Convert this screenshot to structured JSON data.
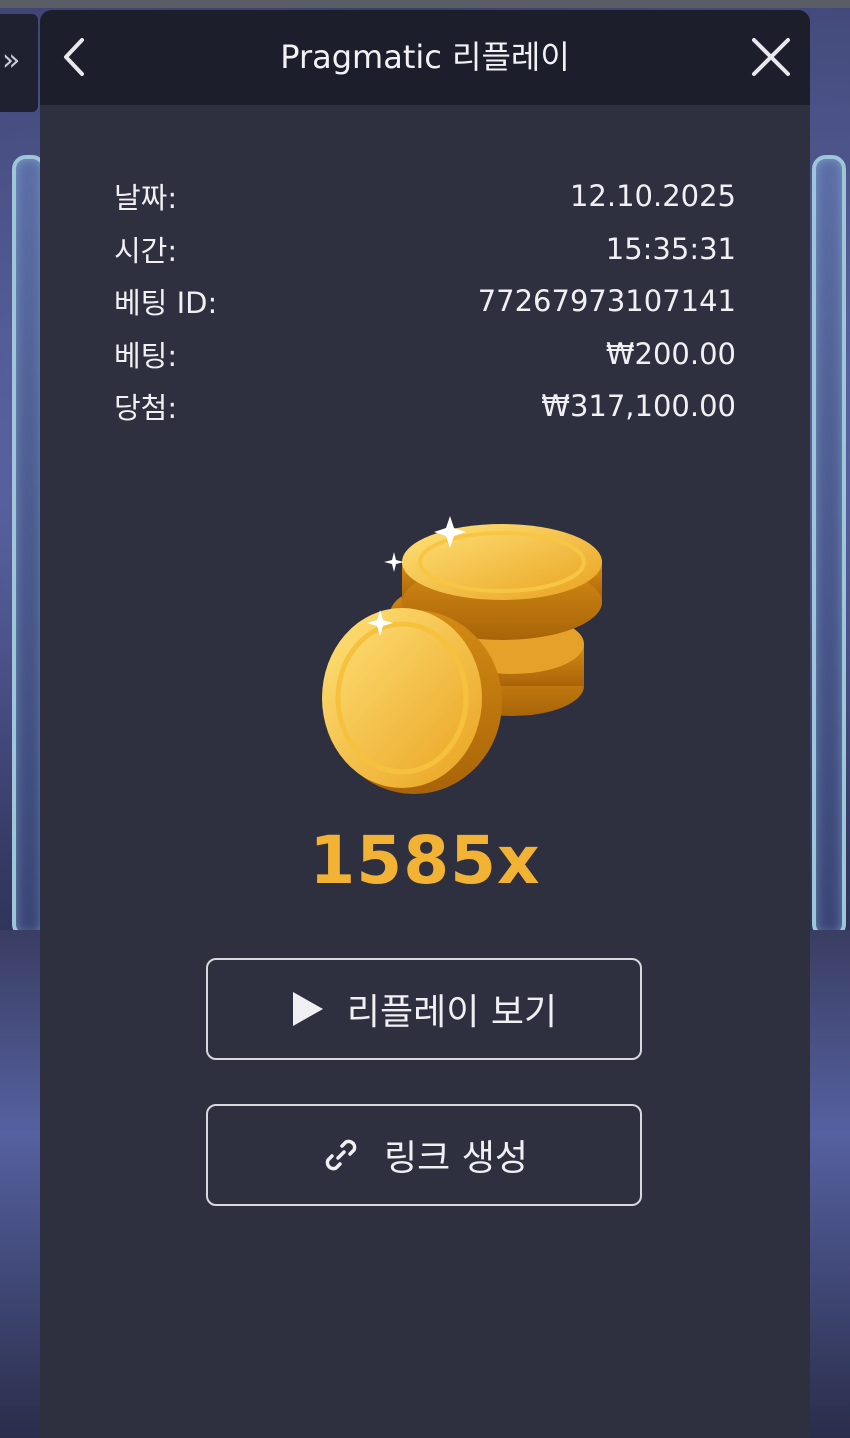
{
  "header": {
    "title": "Pragmatic 리플레이",
    "expand_glyph": "»"
  },
  "info": {
    "rows": [
      {
        "label": "날짜:",
        "value": "12.10.2025"
      },
      {
        "label": "시간:",
        "value": "15:35:31"
      },
      {
        "label": "베팅 ID:",
        "value": "77267973107141"
      },
      {
        "label": "베팅:",
        "value": "₩200.00"
      },
      {
        "label": "당첨:",
        "value": "₩317,100.00"
      }
    ]
  },
  "result": {
    "multiplier": "1585x"
  },
  "buttons": {
    "replay_label": "리플레이 보기",
    "link_label": "링크 생성"
  },
  "icons": {
    "back": "chevron-left-icon",
    "close": "close-icon",
    "play": "play-icon",
    "link": "link-icon",
    "coins": "gold-coins-icon"
  },
  "colors": {
    "modal_bg": "#2e2f3f",
    "header_bg": "#1d1e2b",
    "multiplier": "#f2b233",
    "text": "#f0f0f3"
  }
}
